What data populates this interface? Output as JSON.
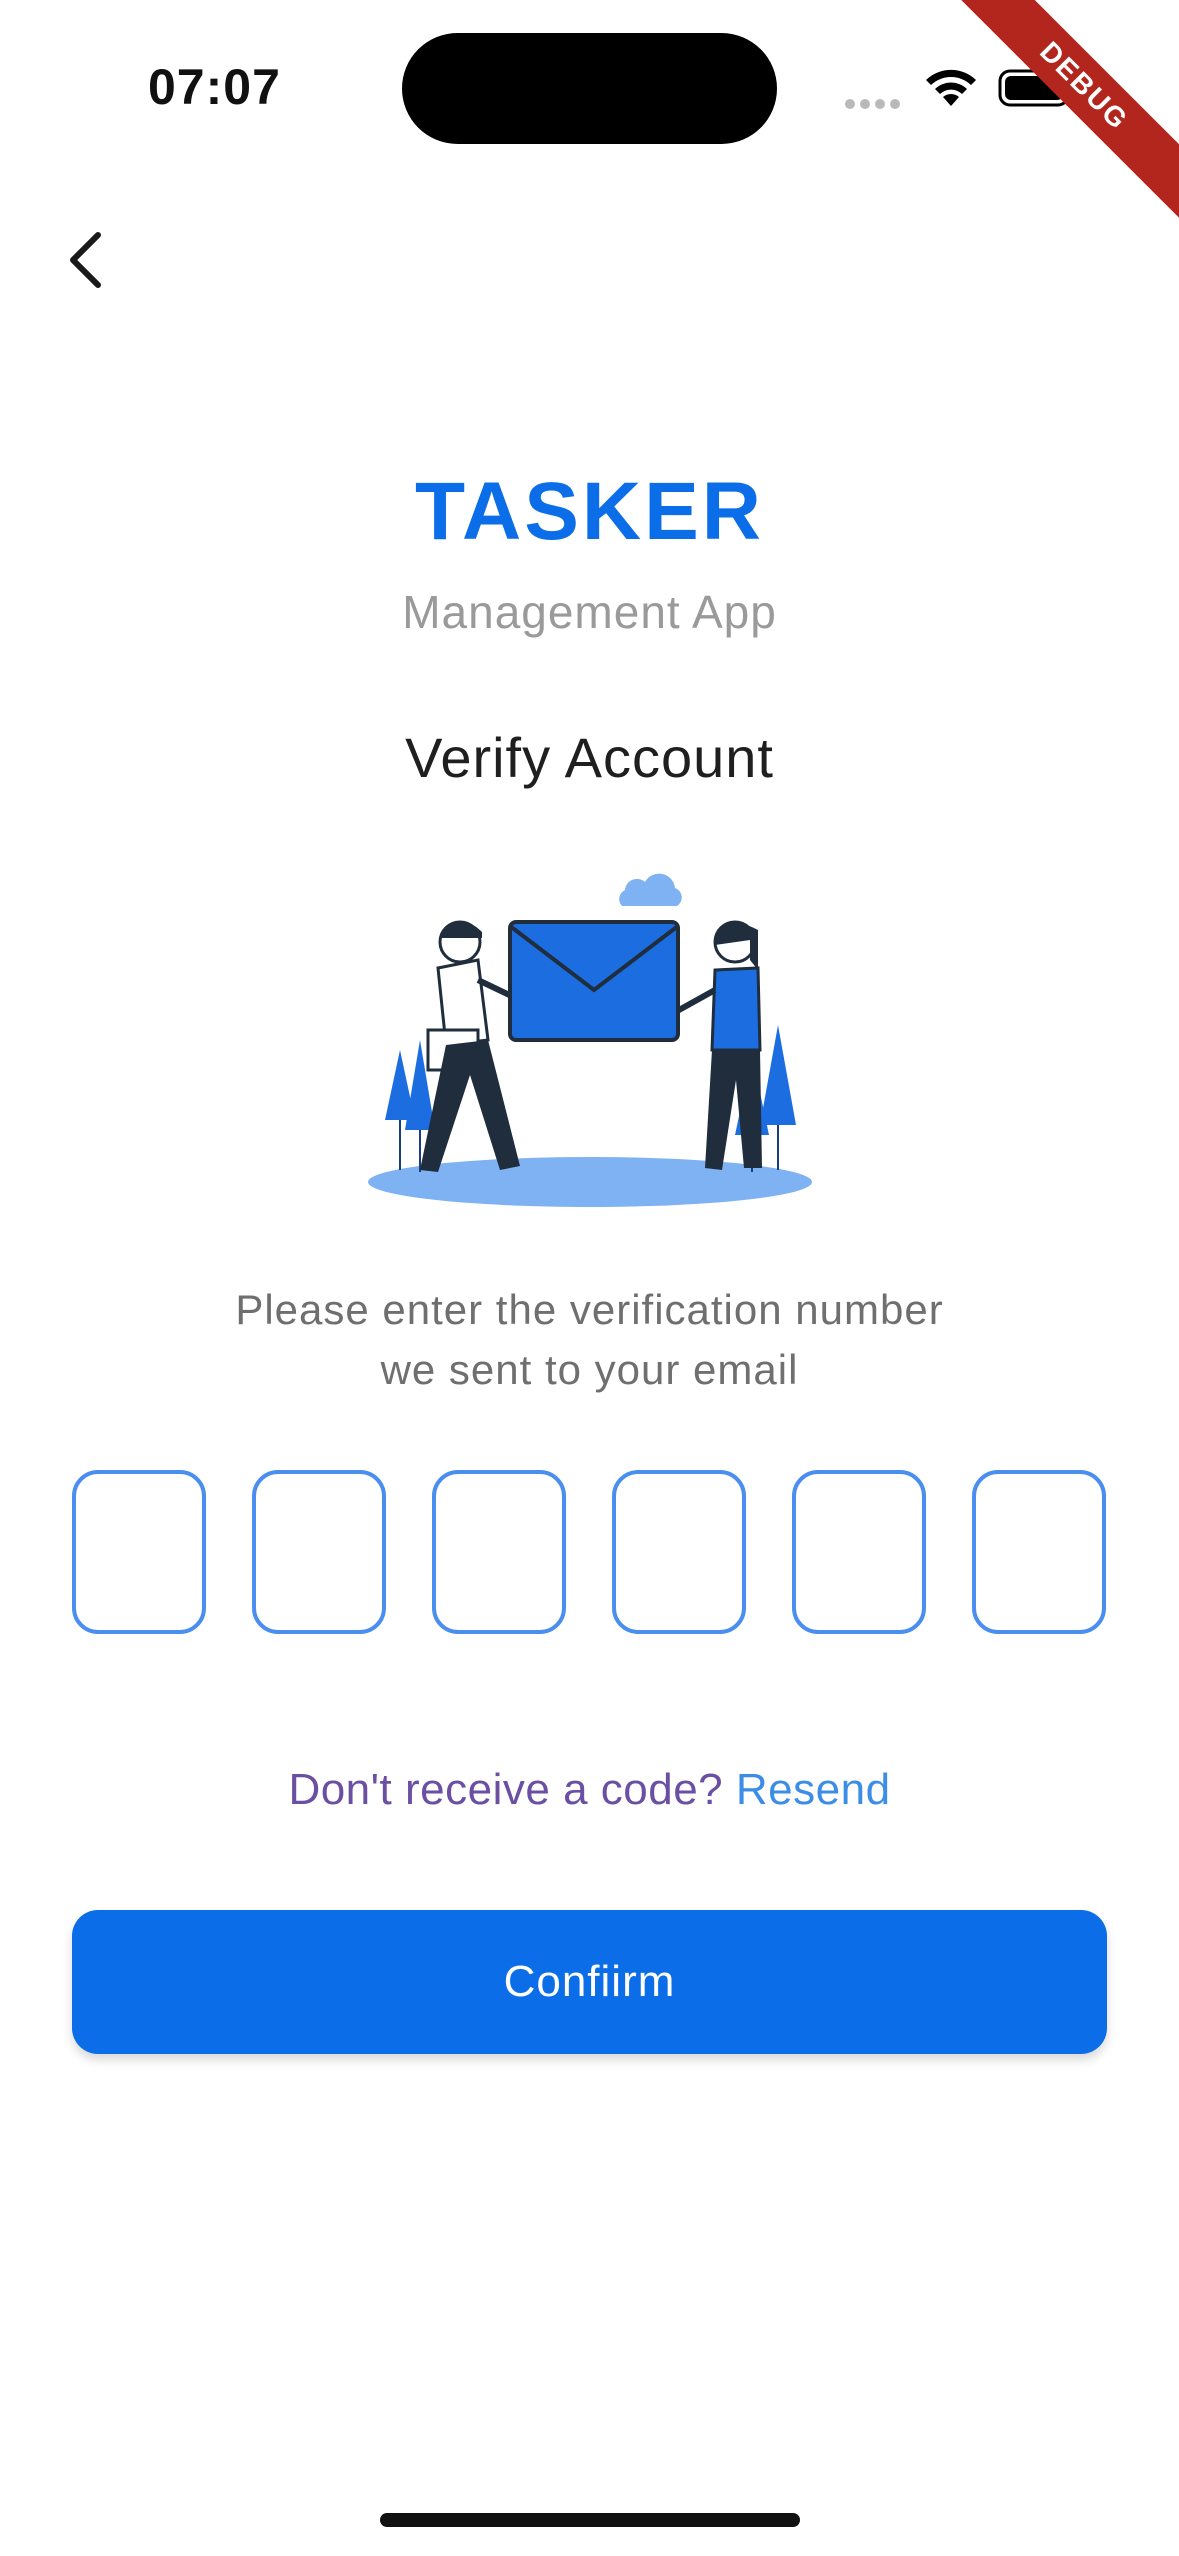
{
  "status_bar": {
    "time": "07:07"
  },
  "debug_label": "DEBUG",
  "header": {
    "title": "TASKER",
    "subtitle": "Management App",
    "heading": "Verify Account"
  },
  "instruction": {
    "line1": "Please enter the verification number",
    "line2": "we sent to your email"
  },
  "code_inputs": [
    "",
    "",
    "",
    "",
    "",
    ""
  ],
  "resend": {
    "text": "Don't receive a code?",
    "link": "Resend"
  },
  "confirm_label": "Confiirm",
  "colors": {
    "primary": "#0b6ee8",
    "code_border": "#4a8ff0",
    "resend_text": "#6a4fa3",
    "resend_link": "#3c8de6"
  },
  "icons": [
    "back-arrow-icon",
    "wifi-icon",
    "battery-icon",
    "cellular-signal-icon"
  ]
}
